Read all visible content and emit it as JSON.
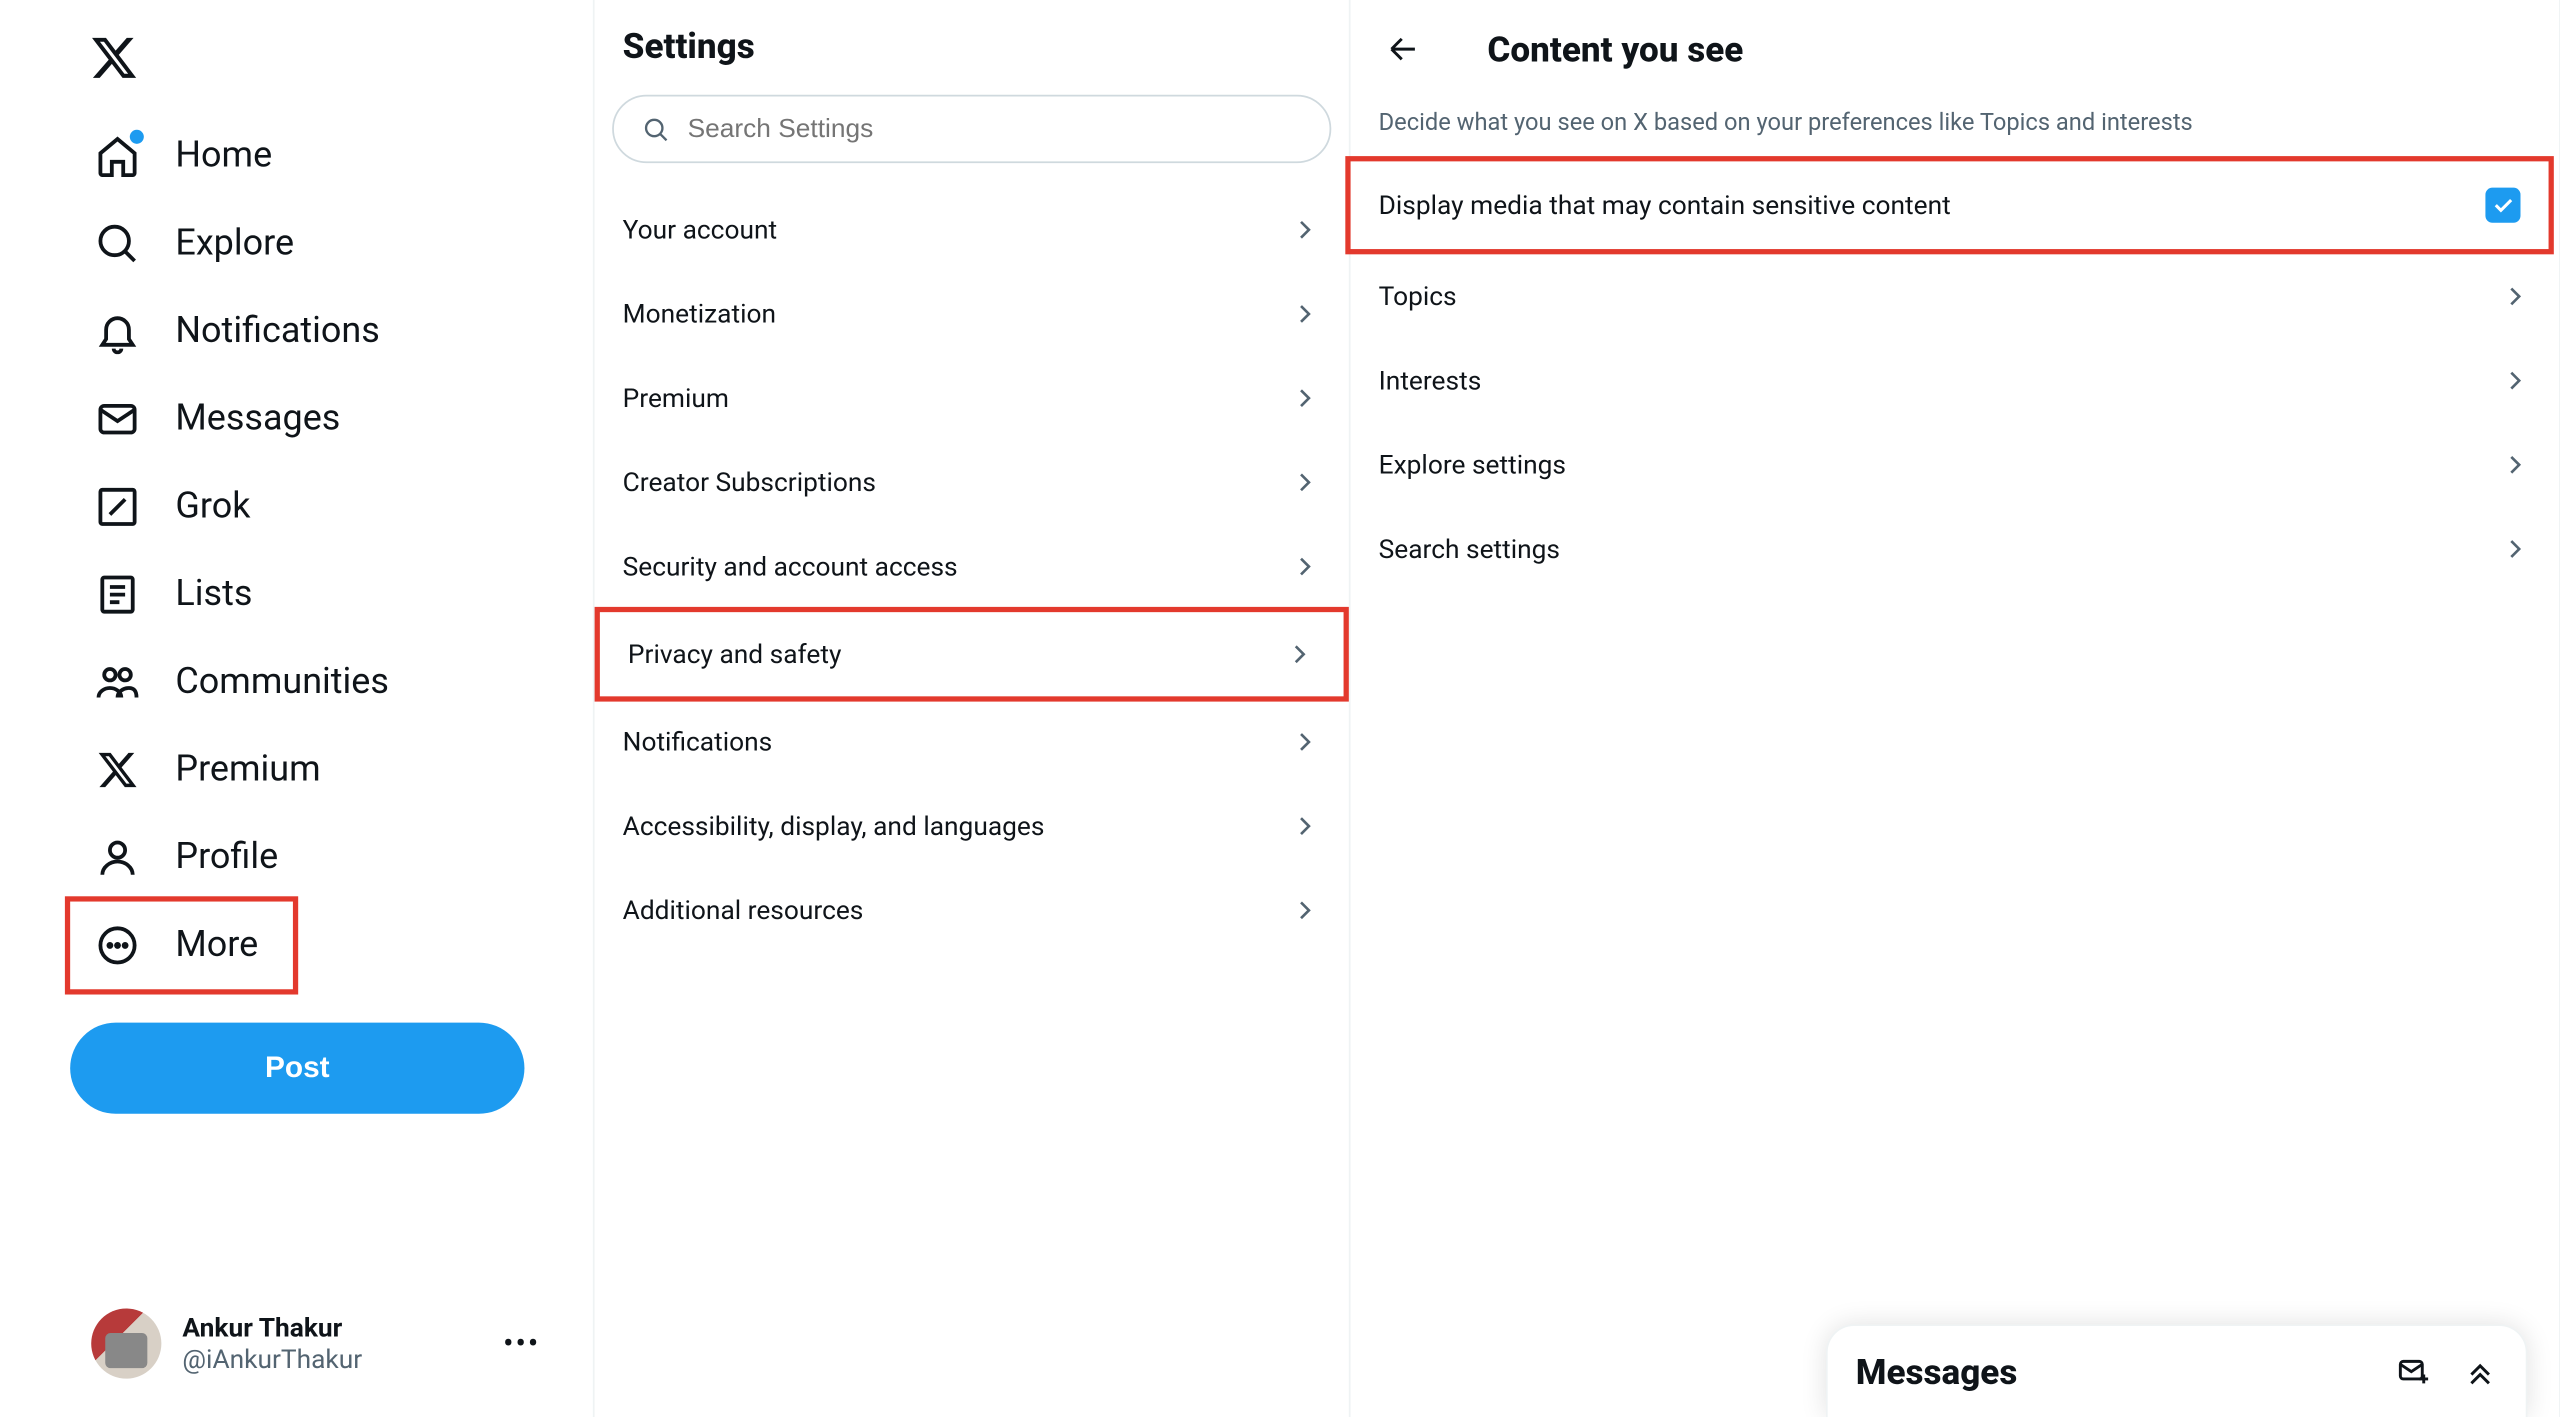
{
  "nav": {
    "items": [
      {
        "id": "home",
        "label": "Home",
        "icon": "home-icon",
        "dot": true
      },
      {
        "id": "explore",
        "label": "Explore",
        "icon": "search-icon"
      },
      {
        "id": "notifications",
        "label": "Notifications",
        "icon": "bell-icon"
      },
      {
        "id": "messages",
        "label": "Messages",
        "icon": "mail-icon"
      },
      {
        "id": "grok",
        "label": "Grok",
        "icon": "grok-icon"
      },
      {
        "id": "lists",
        "label": "Lists",
        "icon": "list-icon"
      },
      {
        "id": "communities",
        "label": "Communities",
        "icon": "communities-icon"
      },
      {
        "id": "premium",
        "label": "Premium",
        "icon": "x-icon"
      },
      {
        "id": "profile",
        "label": "Profile",
        "icon": "profile-icon"
      },
      {
        "id": "more",
        "label": "More",
        "icon": "more-icon",
        "highlighted": true
      }
    ],
    "post_button": "Post"
  },
  "profile": {
    "name": "Ankur Thakur",
    "handle": "@iAnkurThakur"
  },
  "settings": {
    "title": "Settings",
    "search_placeholder": "Search Settings",
    "items": [
      {
        "id": "account",
        "label": "Your account"
      },
      {
        "id": "monetization",
        "label": "Monetization"
      },
      {
        "id": "premium",
        "label": "Premium"
      },
      {
        "id": "creator",
        "label": "Creator Subscriptions"
      },
      {
        "id": "security",
        "label": "Security and account access"
      },
      {
        "id": "privacy",
        "label": "Privacy and safety",
        "selected": true,
        "highlighted": true
      },
      {
        "id": "notifications",
        "label": "Notifications"
      },
      {
        "id": "accessibility",
        "label": "Accessibility, display, and languages"
      },
      {
        "id": "resources",
        "label": "Additional resources"
      }
    ]
  },
  "detail": {
    "title": "Content you see",
    "description": "Decide what you see on X based on your preferences like Topics and interests",
    "items": [
      {
        "id": "sensitive",
        "label": "Display media that may contain sensitive content",
        "type": "checkbox",
        "checked": true,
        "highlighted": true
      },
      {
        "id": "topics",
        "label": "Topics",
        "type": "nav"
      },
      {
        "id": "interests",
        "label": "Interests",
        "type": "nav"
      },
      {
        "id": "explore",
        "label": "Explore settings",
        "type": "nav"
      },
      {
        "id": "search",
        "label": "Search settings",
        "type": "nav"
      }
    ]
  },
  "messages_dock": {
    "label": "Messages"
  },
  "colors": {
    "accent": "#1d9bf0",
    "highlight": "#e3392d",
    "muted": "#536471"
  }
}
